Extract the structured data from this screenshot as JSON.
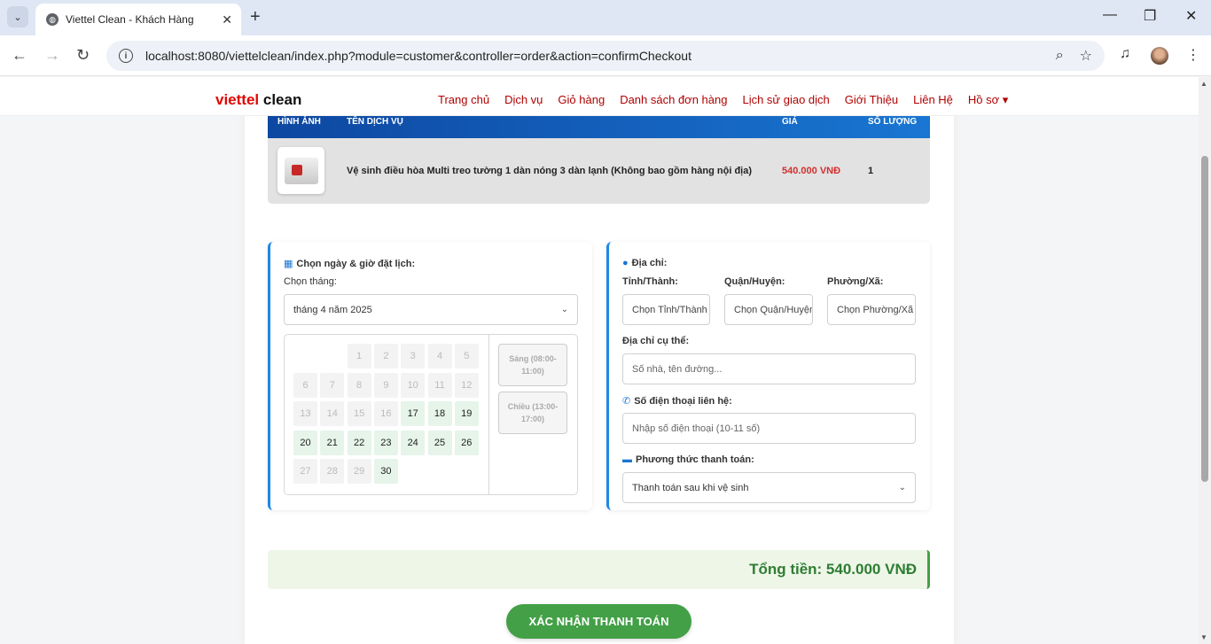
{
  "browser": {
    "tab_title": "Viettel Clean - Khách Hàng",
    "url": "localhost:8080/viettelclean/index.php?module=customer&controller=order&action=confirmCheckout"
  },
  "navbar": {
    "brand_red": "viettel",
    "brand_dark": "clean",
    "menu": [
      "Trang chủ",
      "Dịch vụ",
      "Giỏ hàng",
      "Danh sách đơn hàng",
      "Lịch sử giao dịch",
      "Giới Thiệu",
      "Liên Hệ",
      "Hồ sơ ▾"
    ]
  },
  "table": {
    "headers": {
      "image": "HÌNH ẢNH",
      "name": "TÊN DỊCH VỤ",
      "price": "GIÁ",
      "qty": "SỐ LƯỢNG"
    },
    "row": {
      "name": "Vệ sinh điều hòa Multi treo tường 1 dàn nóng 3 dàn lạnh (Không bao gồm hàng nội địa)",
      "price": "540.000 VNĐ",
      "qty": "1"
    }
  },
  "schedule": {
    "title": "Chọn ngày & giờ đặt lịch:",
    "month_label": "Chọn tháng:",
    "month_value": "tháng 4 năm 2025",
    "days": [
      {
        "d": "1",
        "avail": false
      },
      {
        "d": "2",
        "avail": false
      },
      {
        "d": "3",
        "avail": false
      },
      {
        "d": "4",
        "avail": false
      },
      {
        "d": "5",
        "avail": false
      },
      {
        "d": "6",
        "avail": false
      },
      {
        "d": "7",
        "avail": false
      },
      {
        "d": "8",
        "avail": false
      },
      {
        "d": "9",
        "avail": false
      },
      {
        "d": "10",
        "avail": false
      },
      {
        "d": "11",
        "avail": false
      },
      {
        "d": "12",
        "avail": false
      },
      {
        "d": "13",
        "avail": false
      },
      {
        "d": "14",
        "avail": false
      },
      {
        "d": "15",
        "avail": false
      },
      {
        "d": "16",
        "avail": false
      },
      {
        "d": "17",
        "avail": true
      },
      {
        "d": "18",
        "avail": true
      },
      {
        "d": "19",
        "avail": true
      },
      {
        "d": "20",
        "avail": true
      },
      {
        "d": "21",
        "avail": true
      },
      {
        "d": "22",
        "avail": true
      },
      {
        "d": "23",
        "avail": true
      },
      {
        "d": "24",
        "avail": true
      },
      {
        "d": "25",
        "avail": true
      },
      {
        "d": "26",
        "avail": true
      },
      {
        "d": "27",
        "avail": false
      },
      {
        "d": "28",
        "avail": false
      },
      {
        "d": "29",
        "avail": false
      },
      {
        "d": "30",
        "avail": true
      }
    ],
    "first_weekday_col": 2,
    "slots": [
      "Sáng (08:00-11:00)",
      "Chiều (13:00-17:00)"
    ]
  },
  "address": {
    "title": "Địa chỉ:",
    "province_label": "Tỉnh/Thành:",
    "district_label": "Quận/Huyện:",
    "ward_label": "Phường/Xã:",
    "province_value": "Chọn Tỉnh/Thành",
    "district_value": "Chọn Quận/Huyện",
    "ward_value": "Chọn Phường/Xã",
    "street_label": "Địa chỉ cụ thể:",
    "street_placeholder": "Số nhà, tên đường...",
    "phone_label": "Số điện thoại liên hệ:",
    "phone_placeholder": "Nhập số điện thoại (10-11 số)",
    "payment_label": "Phương thức thanh toán:",
    "payment_value": "Thanh toán sau khi vệ sinh"
  },
  "total": "Tổng tiền: 540.000 VNĐ",
  "confirm_label": "XÁC NHẬN THANH TOÁN",
  "colors": {
    "brand_red": "#e10600",
    "menu": "#b00000",
    "accent_blue": "#1976d2",
    "green": "#43a047"
  }
}
